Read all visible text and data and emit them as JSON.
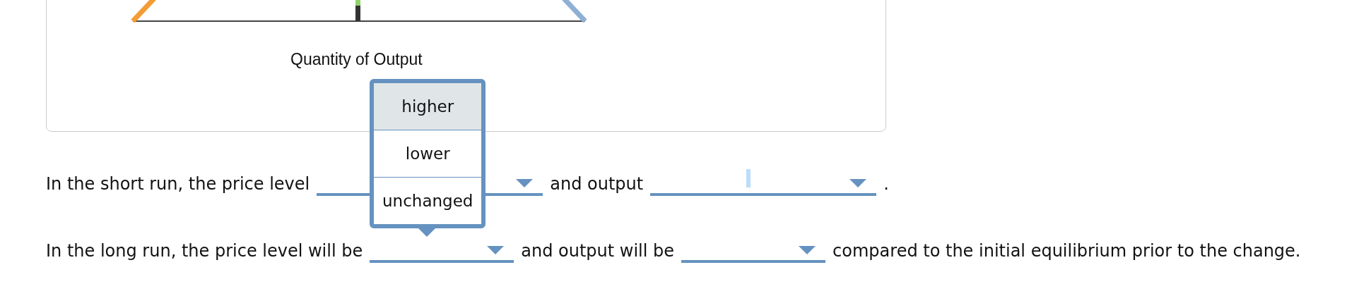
{
  "chart": {
    "x_axis_label": "Quantity of Output"
  },
  "questions": [
    {
      "parts": [
        {
          "kind": "text",
          "text": "In the short run, the price level"
        },
        {
          "kind": "blank"
        },
        {
          "kind": "text",
          "text": "and output"
        },
        {
          "kind": "blank",
          "focused": true
        },
        {
          "kind": "text",
          "text": "."
        }
      ]
    },
    {
      "parts": [
        {
          "kind": "text",
          "text": "In the long run, the price level will be"
        },
        {
          "kind": "blank",
          "open": true,
          "options": [
            {
              "label": "higher",
              "selected": true
            },
            {
              "label": "lower",
              "selected": false
            },
            {
              "label": "unchanged",
              "selected": false
            }
          ]
        },
        {
          "kind": "text",
          "text": "and output will be"
        },
        {
          "kind": "blank"
        },
        {
          "kind": "text",
          "text": "compared to the initial equilibrium prior to the change."
        }
      ]
    }
  ]
}
